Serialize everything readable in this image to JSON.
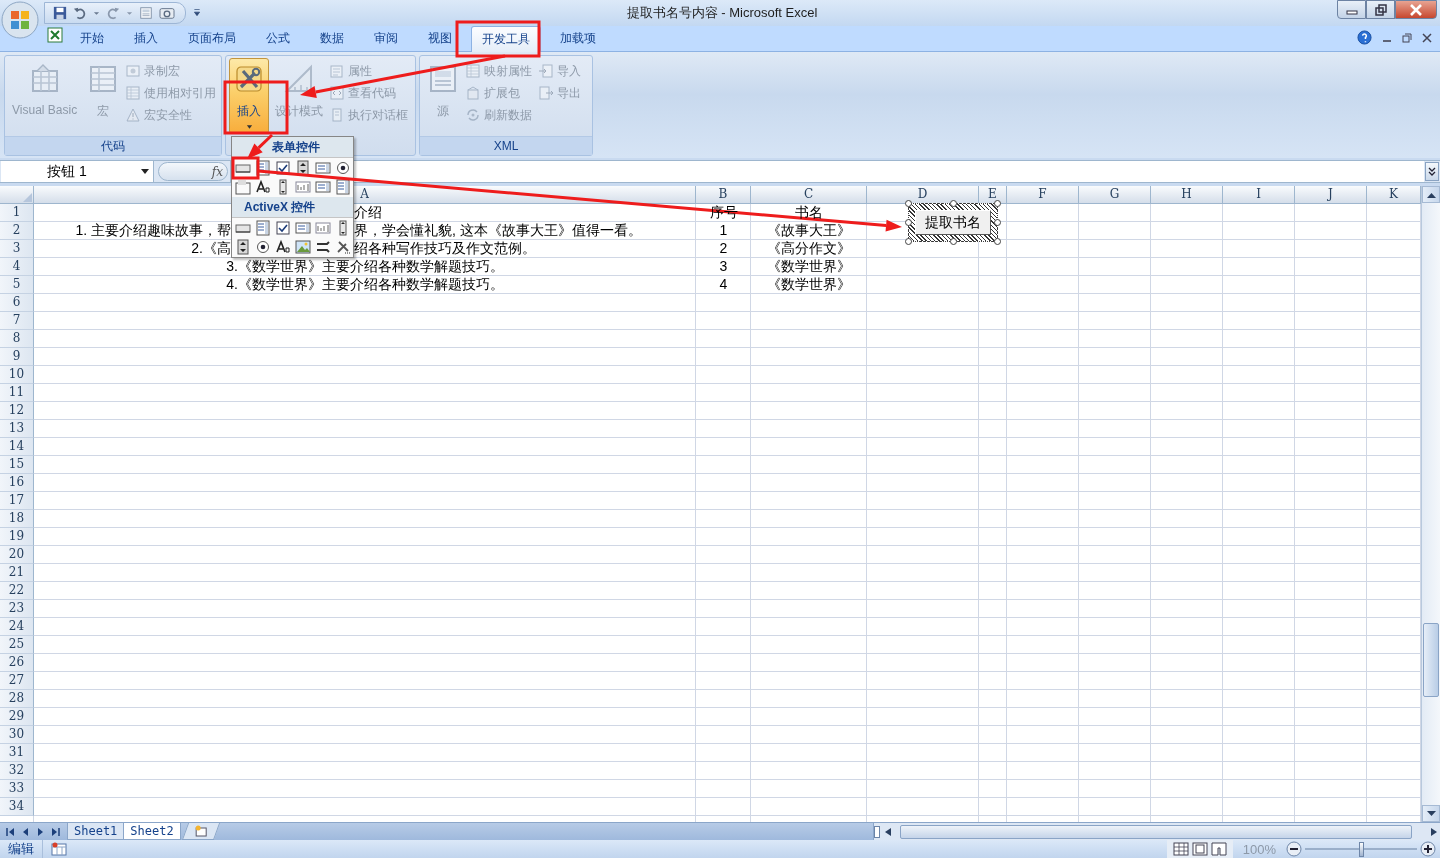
{
  "window": {
    "title": "提取书名号内容 - Microsoft Excel"
  },
  "ribbon_tabs": [
    {
      "label": "开始",
      "selected": false
    },
    {
      "label": "插入",
      "selected": false
    },
    {
      "label": "页面布局",
      "selected": false
    },
    {
      "label": "公式",
      "selected": false
    },
    {
      "label": "数据",
      "selected": false
    },
    {
      "label": "审阅",
      "selected": false
    },
    {
      "label": "视图",
      "selected": false
    },
    {
      "label": "开发工具",
      "selected": true
    },
    {
      "label": "加载项",
      "selected": false
    }
  ],
  "ribbon_groups": [
    {
      "label": "代码",
      "items": [
        {
          "kind": "large",
          "label": "Visual Basic",
          "disabled": true,
          "expanded": false
        },
        {
          "kind": "large",
          "label": "宏",
          "disabled": true,
          "expanded": false
        },
        {
          "kind": "small",
          "label": "录制宏",
          "disabled": true,
          "expanded": false
        },
        {
          "kind": "small",
          "label": "使用相对引用",
          "disabled": true,
          "expanded": false
        },
        {
          "kind": "small",
          "label": "宏安全性",
          "disabled": true,
          "expanded": false
        }
      ]
    },
    {
      "items": [
        {
          "kind": "large",
          "label": "插入",
          "disabled": false,
          "expanded": true
        },
        {
          "kind": "large",
          "label": "设计模式",
          "disabled": true,
          "expanded": false
        },
        {
          "kind": "small",
          "label": "属性",
          "disabled": true,
          "expanded": false
        },
        {
          "kind": "small",
          "label": "查看代码",
          "disabled": true,
          "expanded": false
        },
        {
          "kind": "small",
          "label": "执行对话框",
          "disabled": true,
          "expanded": false
        }
      ]
    },
    {
      "label": "XML",
      "items": [
        {
          "kind": "large",
          "label": "源",
          "disabled": true,
          "expanded": false
        },
        {
          "kind": "small",
          "label": "映射属性",
          "disabled": true,
          "expanded": false
        },
        {
          "kind": "small",
          "label": "扩展包",
          "disabled": true,
          "expanded": false
        },
        {
          "kind": "small",
          "label": "刷新数据",
          "disabled": true,
          "expanded": false
        },
        {
          "kind": "small",
          "label": "导入",
          "disabled": true,
          "expanded": false
        },
        {
          "kind": "small",
          "label": "导出",
          "disabled": true,
          "expanded": false
        }
      ]
    }
  ],
  "formula_bar": {
    "name_box": "按钮 1",
    "function_label": "fx"
  },
  "insert_menu": {
    "sections": [
      {
        "title": "表单控件"
      },
      {
        "title": "ActiveX 控件"
      }
    ]
  },
  "sheet": {
    "columns": [
      "A",
      "B",
      "C",
      "D",
      "E",
      "F",
      "G",
      "H",
      "I",
      "J",
      "K"
    ],
    "rows": [
      {
        "header": "1",
        "a": {
          "kind": "split",
          "right": "介绍"
        },
        "b": "序号",
        "c": "书名"
      },
      {
        "header": "2",
        "a": {
          "kind": "split",
          "left": "1. 主要介绍趣味故事，帮",
          "right": "界，学会懂礼貌, 这本《故事大王》值得一看。"
        },
        "b": "1",
        "c": "《故事大王》"
      },
      {
        "header": "3",
        "a": {
          "kind": "split",
          "left": "2.《高",
          "right": "绍各种写作技巧及作文范例。"
        },
        "b": "2",
        "c": "《高分作文》"
      },
      {
        "header": "4",
        "a": {
          "kind": "full",
          "text": "3.《数学世界》主要介绍各种数学解题技巧。"
        },
        "b": "3",
        "c": "《数学世界》"
      },
      {
        "header": "5",
        "a": {
          "kind": "full",
          "text": "4.《数学世界》主要介绍各种数学解题技巧。"
        },
        "b": "4",
        "c": "《数学世界》"
      },
      {
        "header": "6"
      },
      {
        "header": "7"
      },
      {
        "header": "8"
      },
      {
        "header": "9"
      },
      {
        "header": "10"
      },
      {
        "header": "11"
      },
      {
        "header": "12"
      },
      {
        "header": "13"
      },
      {
        "header": "14"
      },
      {
        "header": "15"
      },
      {
        "header": "16"
      },
      {
        "header": "17"
      },
      {
        "header": "18"
      },
      {
        "header": "19"
      },
      {
        "header": "20"
      },
      {
        "header": "21"
      },
      {
        "header": "22"
      },
      {
        "header": "23"
      },
      {
        "header": "24"
      },
      {
        "header": "25"
      },
      {
        "header": "26"
      },
      {
        "header": "27"
      },
      {
        "header": "28"
      },
      {
        "header": "29"
      },
      {
        "header": "30"
      },
      {
        "header": "31"
      },
      {
        "header": "32"
      },
      {
        "header": "33"
      },
      {
        "header": "34"
      }
    ]
  },
  "sheet_button": {
    "label": "提取书名",
    "selected": true
  },
  "sheet_tabs": [
    {
      "label": "Sheet1",
      "selected": false
    },
    {
      "label": "Sheet2",
      "selected": true
    }
  ],
  "status_bar": {
    "mode": "编辑",
    "zoom": "100%"
  },
  "zoom_slider": {
    "level": 0.5
  }
}
